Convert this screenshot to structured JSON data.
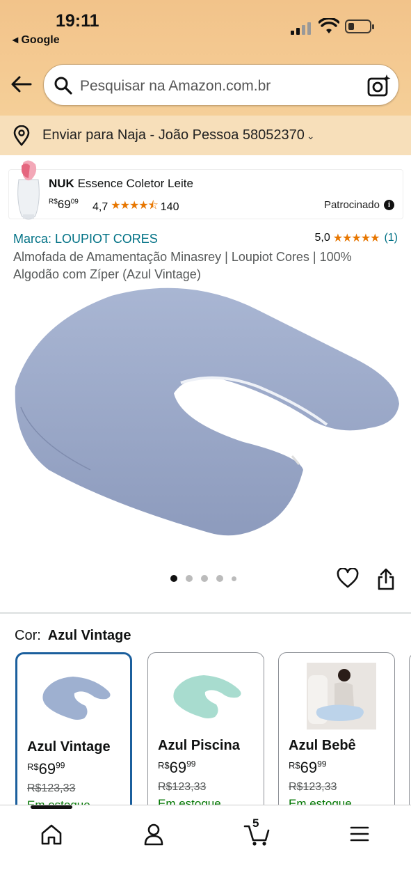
{
  "status": {
    "time": "19:11",
    "back_app": "◂ Google"
  },
  "header": {
    "search_placeholder": "Pesquisar na Amazon.com.br"
  },
  "delivery": {
    "text": "Enviar para Naja - João Pessoa 58052370",
    "chevron": "⌄"
  },
  "sponsored": {
    "brand": "NUK",
    "title": "Essence Coletor Leite",
    "price_currency": "R$",
    "price_int": "69",
    "price_frac": "09",
    "rating": "4,7",
    "stars": "★★★★⯪",
    "reviews": "140",
    "label": "Patrocinado",
    "info": "i"
  },
  "product": {
    "brand_link": "Marca: LOUPIOT CORES",
    "rating": "5,0",
    "stars": "★★★★★",
    "reviews": "(1)",
    "title": "Almofada de Amamentação Minasrey | Loupiot Cores | 100% Algodão com Zíper (Azul Vintage)"
  },
  "gallery": {
    "dots_total": 5,
    "active_dot": 0
  },
  "variation": {
    "label": "Cor:",
    "selected": "Azul Vintage",
    "options": [
      {
        "name": "Azul Vintage",
        "currency": "R$",
        "price_int": "69",
        "price_frac": "99",
        "old_price": "R$123,33",
        "stock": "Em estoque",
        "color": "#9eb0d0"
      },
      {
        "name": "Azul Piscina",
        "currency": "R$",
        "price_int": "69",
        "price_frac": "99",
        "old_price": "R$123,33",
        "stock": "Em estoque",
        "color": "#a8dccf"
      },
      {
        "name": "Azul Bebê",
        "currency": "R$",
        "price_int": "69",
        "price_frac": "99",
        "old_price": "R$123,33",
        "stock": "Em estoque",
        "color": "#bcd3ea"
      }
    ]
  },
  "nav": {
    "cart_count": "5"
  },
  "colors": {
    "accent": "#f2c38a",
    "link": "#007185",
    "star": "#e77600",
    "selected_border": "#1b5f9d",
    "in_stock": "#007600"
  }
}
